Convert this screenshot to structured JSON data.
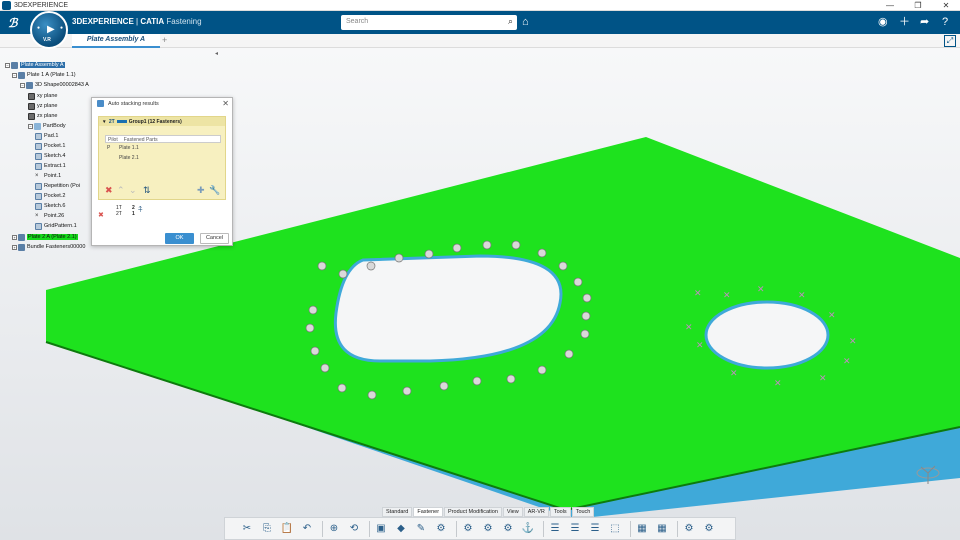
{
  "window": {
    "title": "3DEXPERIENCE",
    "controls": [
      "—",
      "❐",
      "✕"
    ]
  },
  "header": {
    "brand_bold": "3DEXPERIENCE",
    "brand_sep": " | ",
    "brand_product": "CATIA",
    "brand_app": "Fastening",
    "search_placeholder": "Search",
    "compass_version": "V.R",
    "accent": "#005386"
  },
  "tabs": [
    {
      "label": "Plate Assembly A"
    }
  ],
  "tab_add": "+",
  "tree": [
    {
      "label": "Plate Assembly A",
      "level": 0,
      "icon": "product",
      "selected": true
    },
    {
      "label": "Plate 1 A (Plate 1.1)",
      "level": 1,
      "icon": "product"
    },
    {
      "label": "3D Shape00002843 A",
      "level": 2,
      "icon": "product"
    },
    {
      "label": "xy plane",
      "level": 3,
      "icon": "plane"
    },
    {
      "label": "yz plane",
      "level": 3,
      "icon": "plane"
    },
    {
      "label": "zx plane",
      "level": 3,
      "icon": "plane"
    },
    {
      "label": "PartBody",
      "level": 3,
      "icon": "body"
    },
    {
      "label": "Pad.1",
      "level": 4,
      "icon": "feature"
    },
    {
      "label": "Pocket.1",
      "level": 4,
      "icon": "feature"
    },
    {
      "label": "Sketch.4",
      "level": 4,
      "icon": "feature"
    },
    {
      "label": "Extract.1",
      "level": 4,
      "icon": "feature"
    },
    {
      "label": "Point.1",
      "level": 4,
      "icon": "point"
    },
    {
      "label": "Repetition (Poi",
      "level": 4,
      "icon": "feature"
    },
    {
      "label": "Pocket.2",
      "level": 4,
      "icon": "feature"
    },
    {
      "label": "Sketch.6",
      "level": 4,
      "icon": "feature"
    },
    {
      "label": "Point.26",
      "level": 4,
      "icon": "point"
    },
    {
      "label": "GridPattern.1",
      "level": 4,
      "icon": "feature"
    },
    {
      "label": "Plate 2 A (Plate 2.1)",
      "level": 1,
      "icon": "product",
      "highlight": true
    },
    {
      "label": "Bundle Fasteners00000",
      "level": 1,
      "icon": "product"
    }
  ],
  "dialog": {
    "title": "Auto stacking results",
    "close": "✕",
    "group_label": "Group1 (12 Fasteners)",
    "group_code": "2T",
    "col_pilot": "Pilot",
    "col_parts": "Fastened Parts",
    "rows": [
      {
        "pilot": "P",
        "part": "Plate 1.1"
      },
      {
        "pilot": "",
        "part": "Plate 2.1"
      }
    ],
    "stack_top": "1T",
    "stack_top_count": "2",
    "stack_bottom": "2T",
    "stack_bottom_count": "1",
    "ok": "OK",
    "cancel": "Cancel"
  },
  "action_tabs": [
    "Standard",
    "Fastener",
    "Product Modification",
    "View",
    "AR-VR",
    "Tools",
    "Touch"
  ],
  "action_tab_active": "Fastener",
  "toolbar_icons": [
    "cut-icon",
    "copy-icon",
    "paste-icon",
    "undo-icon",
    "zoom-icon",
    "rotate-icon",
    "cube-icon",
    "shading-icon",
    "pen-icon",
    "fastener-icon",
    "fastener2-icon",
    "fastener3-icon",
    "fastener4-icon",
    "anchor-icon",
    "stack-icon",
    "stack2-icon",
    "stack3-icon",
    "select-icon",
    "table-icon",
    "grid-icon",
    "group-icon",
    "settings-icon"
  ],
  "colors": {
    "plate": "#1ee21e",
    "plate_edge": "#0d7a0d",
    "plate_under": "#3fa9d9",
    "fastener": "#c9a5c9"
  }
}
